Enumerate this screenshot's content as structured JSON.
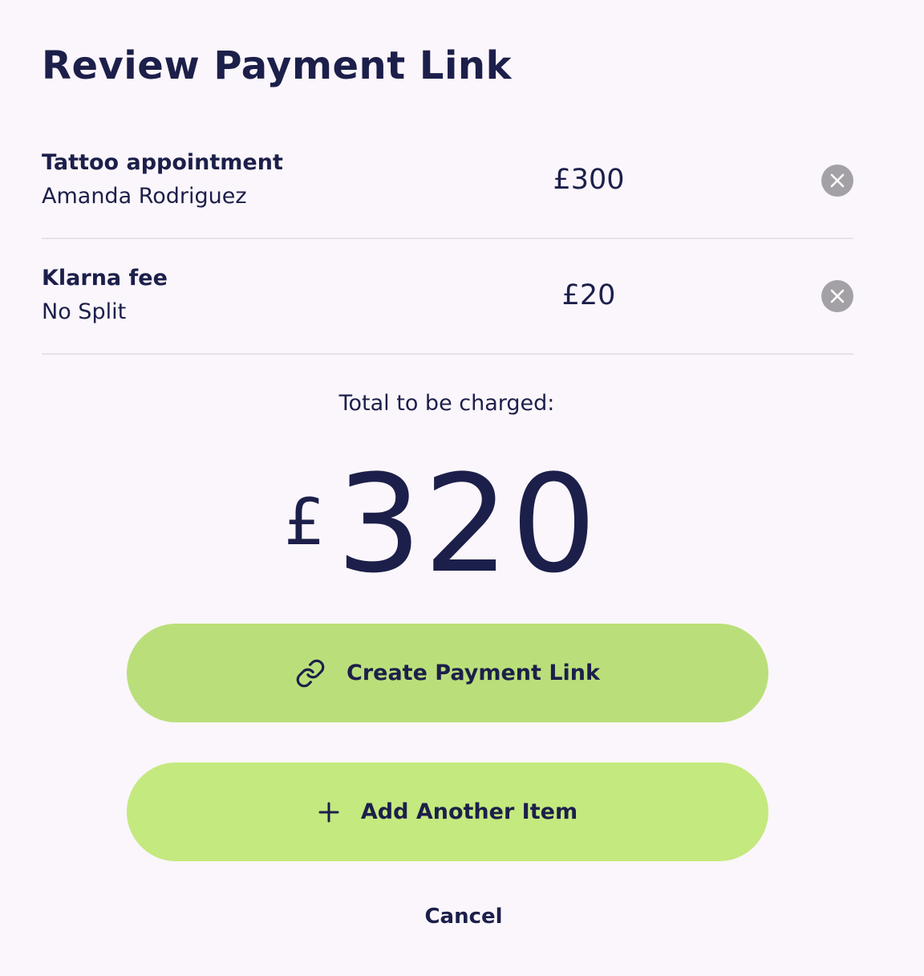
{
  "header": {
    "title": "Review Payment Link"
  },
  "items": [
    {
      "name": "Tattoo appointment",
      "subtitle": "Amanda Rodriguez",
      "price": "£300",
      "remove_icon": "close-circle-icon"
    },
    {
      "name": "Klarna fee",
      "subtitle": "No Split",
      "price": "£20",
      "remove_icon": "close-circle-icon"
    }
  ],
  "total": {
    "label": "Total to be charged:",
    "currency": "£",
    "amount": "320"
  },
  "actions": {
    "create_label": "Create Payment Link",
    "create_icon": "link-icon",
    "add_label": "Add Another Item",
    "add_icon": "plus-icon",
    "cancel_label": "Cancel"
  },
  "colors": {
    "background": "#faf6fb",
    "text": "#1c1f4a",
    "create_button": "#badf7a",
    "add_button": "#c4e97f",
    "remove_button": "#a4a1a6",
    "divider": "#e6e1e8"
  }
}
